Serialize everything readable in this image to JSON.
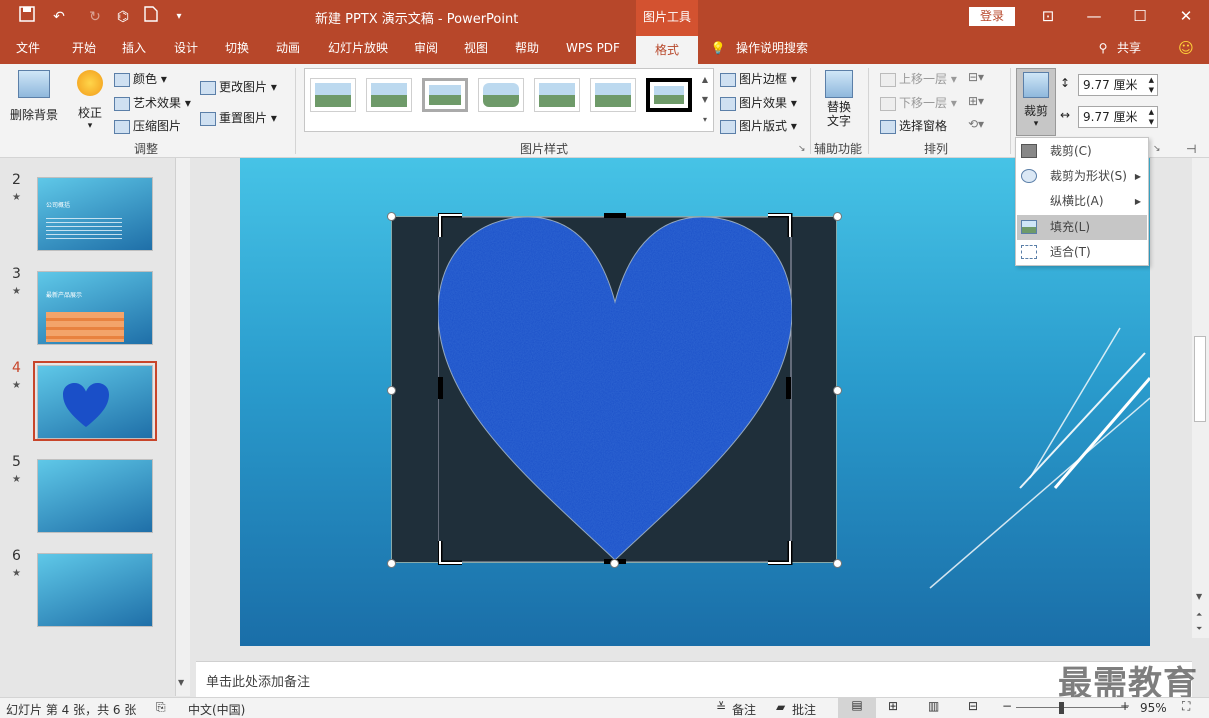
{
  "titlebar": {
    "title": "新建 PPTX 演示文稿  -  PowerPoint",
    "context_tools": "图片工具",
    "login": "登录",
    "minimize": "—",
    "restore": "☐",
    "close": "✕"
  },
  "tabs": [
    "文件",
    "开始",
    "插入",
    "设计",
    "切换",
    "动画",
    "幻灯片放映",
    "审阅",
    "视图",
    "帮助",
    "WPS PDF",
    "格式"
  ],
  "tell_me": "操作说明搜索",
  "share": "共享",
  "ribbon": {
    "remove_bg": "删除背景",
    "corrections": "校正",
    "color": "颜色",
    "artistic": "艺术效果",
    "compress": "压缩图片",
    "change_pic": "更改图片",
    "reset_pic": "重置图片",
    "group_adjust": "调整",
    "pic_border": "图片边框",
    "pic_effects": "图片效果",
    "pic_layout": "图片版式",
    "group_styles": "图片样式",
    "alt_text": "替换\n文字",
    "alt_text_l1": "替换",
    "alt_text_l2": "文字",
    "group_access": "辅助功能",
    "bring_fwd": "上移一层",
    "send_back": "下移一层",
    "sel_pane": "选择窗格",
    "group_arrange": "排列",
    "crop": "裁剪",
    "height": "9.77 厘米",
    "width": "9.77 厘米"
  },
  "crop_menu": [
    {
      "label": "裁剪(C)",
      "arrow": false
    },
    {
      "label": "裁剪为形状(S)",
      "arrow": true
    },
    {
      "label": "纵横比(A)",
      "arrow": true
    },
    {
      "label": "填充(L)",
      "arrow": false
    },
    {
      "label": "适合(T)",
      "arrow": false
    }
  ],
  "slides": [
    {
      "num": "2",
      "star": "★",
      "title": "公司概括"
    },
    {
      "num": "3",
      "star": "★",
      "title": "最新产品展示"
    },
    {
      "num": "4",
      "star": "★",
      "title": ""
    },
    {
      "num": "5",
      "star": "★",
      "title": ""
    },
    {
      "num": "6",
      "star": "★",
      "title": ""
    }
  ],
  "notes_placeholder": "单击此处添加备注",
  "status": {
    "slide_info": "幻灯片 第 4 张，共 6 张",
    "language": "中文(中国)",
    "notes": "备注",
    "comments": "批注",
    "zoom": "95%",
    "zoom_level": 0.95
  },
  "watermark": "最需教育",
  "colors": {
    "accent": "#b7472a",
    "selection": "#c8452a",
    "heart": "#1a4fc8"
  }
}
